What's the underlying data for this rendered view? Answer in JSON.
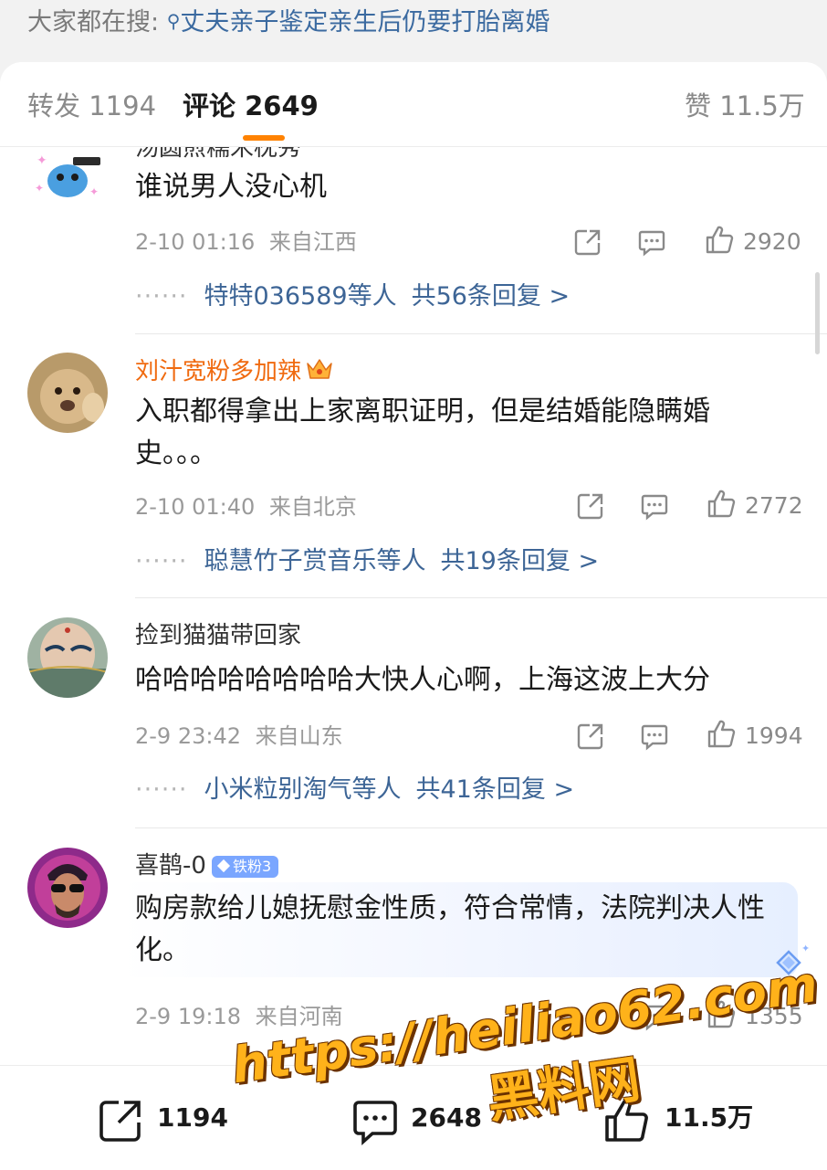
{
  "search": {
    "prefix": "大家都在搜:",
    "query": "丈夫亲子鉴定亲生后仍要打胎离婚"
  },
  "tabs": [
    {
      "label": "转发",
      "count": "1194"
    },
    {
      "label": "评论",
      "count": "2649"
    },
    {
      "label": "赞",
      "count": "11.5万"
    }
  ],
  "comments": [
    {
      "name": "汤圆煎糯米枕秀",
      "text": "谁说男人没心机",
      "time": "2-10 01:16",
      "location": "来自江西",
      "likes": "2920",
      "replies_by": "特特036589等人",
      "replies_total": "共56条回复 >"
    },
    {
      "name": "刘汁宽粉多加辣",
      "text": "入职都得拿出上家离职证明，但是结婚能隐瞒婚史。。。",
      "time": "2-10 01:40",
      "location": "来自北京",
      "likes": "2772",
      "replies_by": "聪慧竹子赏音乐等人",
      "replies_total": "共19条回复 >"
    },
    {
      "name": "捡到猫猫带回家",
      "text": "哈哈哈哈哈哈哈哈大快人心啊，上海这波上大分",
      "time": "2-9 23:42",
      "location": "来自山东",
      "likes": "1994",
      "replies_by": "小米粒别淘气等人",
      "replies_total": "共41条回复 >"
    },
    {
      "name": "喜鹊-0",
      "badge": "铁粉3",
      "text": "购房款给儿媳抚慰金性质，符合常情，法院判决人性化。",
      "time": "2-9 19:18",
      "location": "来自河南",
      "likes": "1355"
    }
  ],
  "bottom_bar": {
    "repost": "1194",
    "comment": "2648",
    "like": "11.5万"
  },
  "watermark": {
    "url": "https://heiliao62.com",
    "name": "黑料网"
  },
  "colors": {
    "accent": "#ff8200",
    "link": "#3d6596",
    "vip_name": "#f06a0f",
    "watermark": "#ffb21a"
  }
}
